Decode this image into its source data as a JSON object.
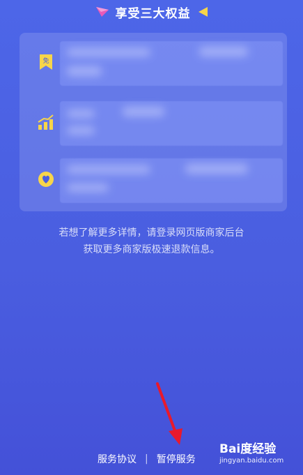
{
  "header": {
    "title": "享受三大权益",
    "left_icon": "paper-plane-icon",
    "right_icon": "flag-icon"
  },
  "benefits": [
    {
      "icon": "free-badge-icon",
      "icon_text": "免"
    },
    {
      "icon": "growth-chart-icon"
    },
    {
      "icon": "heart-badge-icon"
    }
  ],
  "info": {
    "line1": "若想了解更多详情，请登录网页版商家后台",
    "line2": "获取更多商家版极速退款信息。"
  },
  "footer": {
    "agreement": "服务协议",
    "separator": "|",
    "pause": "暂停服务"
  },
  "watermark": {
    "brand": "Bai度经验",
    "url": "jingyan.baidu.com"
  },
  "colors": {
    "background_top": "#4d66e8",
    "background_bottom": "#4451d8",
    "icon_yellow": "#f7d54a",
    "arrow_red": "#e8192c",
    "plane_pink": "#e85ab8"
  }
}
